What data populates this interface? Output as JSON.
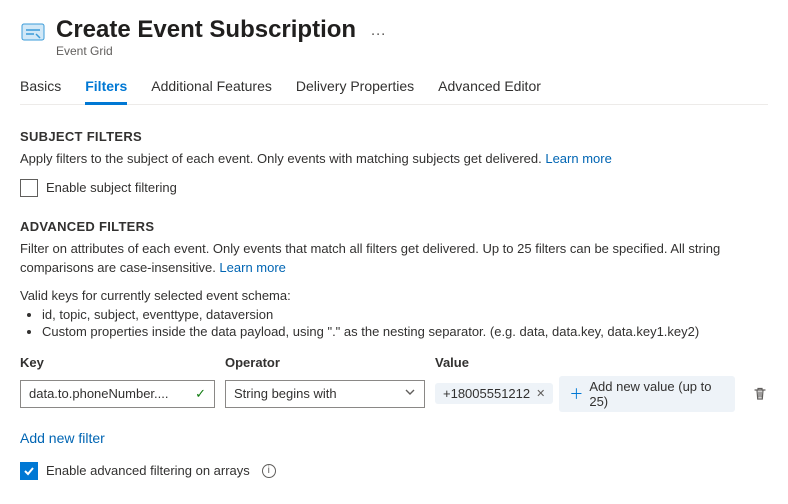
{
  "header": {
    "title": "Create Event Subscription",
    "subtitle": "Event Grid",
    "more": "…"
  },
  "tabs": {
    "items": [
      {
        "label": "Basics",
        "active": false
      },
      {
        "label": "Filters",
        "active": true
      },
      {
        "label": "Additional Features",
        "active": false
      },
      {
        "label": "Delivery Properties",
        "active": false
      },
      {
        "label": "Advanced Editor",
        "active": false
      }
    ]
  },
  "subject": {
    "title": "SUBJECT FILTERS",
    "desc": "Apply filters to the subject of each event. Only events with matching subjects get delivered. ",
    "learn_more": "Learn more",
    "enable_label": "Enable subject filtering",
    "enabled": false
  },
  "advanced": {
    "title": "ADVANCED FILTERS",
    "desc": "Filter on attributes of each event. Only events that match all filters get delivered. Up to 25 filters can be specified. All string comparisons are case-insensitive. ",
    "learn_more": "Learn more",
    "keys_intro": "Valid keys for currently selected event schema:",
    "keys": [
      "id, topic, subject, eventtype, dataversion",
      "Custom properties inside the data payload, using \".\" as the nesting separator. (e.g. data, data.key, data.key1.key2)"
    ],
    "columns": {
      "key": "Key",
      "operator": "Operator",
      "value": "Value"
    },
    "row": {
      "key": "data.to.phoneNumber....",
      "operator": "String begins with",
      "value": "+18005551212",
      "add_value_label": "Add new value (up to 25)"
    },
    "add_filter": "Add new filter",
    "arrays_label": "Enable advanced filtering on arrays",
    "arrays_enabled": true
  }
}
